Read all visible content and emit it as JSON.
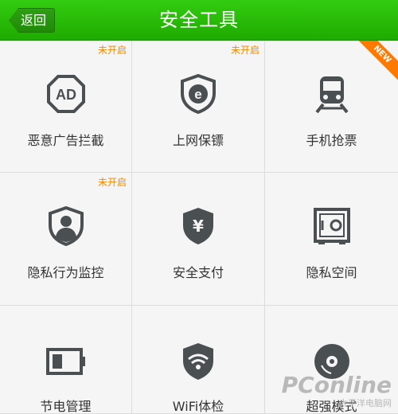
{
  "header": {
    "back_label": "返回",
    "title": "安全工具"
  },
  "tools": [
    {
      "label": "恶意广告拦截",
      "status": "未开启",
      "icon": "ad-block-icon"
    },
    {
      "label": "上网保镖",
      "status": "未开启",
      "icon": "browser-shield-icon"
    },
    {
      "label": "手机抢票",
      "badge": "NEW",
      "icon": "train-icon"
    },
    {
      "label": "隐私行为监控",
      "status": "未开启",
      "icon": "privacy-monitor-icon"
    },
    {
      "label": "安全支付",
      "icon": "secure-pay-icon"
    },
    {
      "label": "隐私空间",
      "icon": "safe-box-icon"
    },
    {
      "label": "节电管理",
      "icon": "battery-icon"
    },
    {
      "label": "WiFi体检",
      "icon": "wifi-shield-icon"
    },
    {
      "label": "超强模式",
      "icon": "disc-icon"
    }
  ],
  "watermark": {
    "brand": "PConline",
    "sub": "太平洋电脑网"
  },
  "colors": {
    "header_green": "#22b000",
    "status_orange": "#ee8a00",
    "icon_gray": "#4a4f52"
  }
}
